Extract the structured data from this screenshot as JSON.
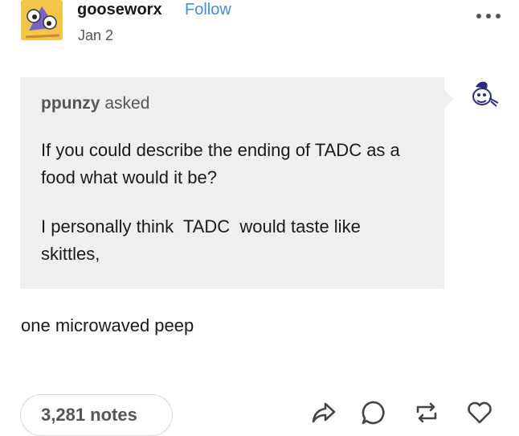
{
  "post": {
    "username": "gooseworx",
    "follow_label": "Follow",
    "date": "Jan 2"
  },
  "ask": {
    "asker": "ppunzy",
    "asked_word": "asked",
    "question": "If you could describe the ending of TADC as a food what would it be?",
    "comment": "I personally think  TADC  would taste like skittles,"
  },
  "answer": {
    "text": "one microwaved peep"
  },
  "footer": {
    "notes": "3,281 notes",
    "actions": [
      "share-icon",
      "reply-icon",
      "reblog-icon",
      "like-icon"
    ]
  },
  "icons": {
    "more": "more-options-icon"
  },
  "colors": {
    "link": "#3e8fe0",
    "ask_background": "#efefef",
    "avatar_background": "#f3c54a"
  }
}
